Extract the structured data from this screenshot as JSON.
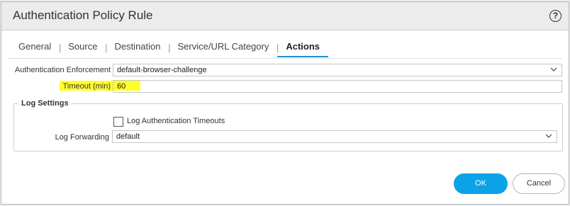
{
  "dialog": {
    "title": "Authentication Policy Rule",
    "help_symbol": "?"
  },
  "tabs": [
    {
      "label": "General"
    },
    {
      "label": "Source"
    },
    {
      "label": "Destination"
    },
    {
      "label": "Service/URL Category"
    },
    {
      "label": "Actions",
      "active": true
    }
  ],
  "tab_separator": "|",
  "form": {
    "auth_enforcement_label": "Authentication Enforcement",
    "auth_enforcement_value": "default-browser-challenge",
    "timeout_label": "Timeout (min)",
    "timeout_value": "60",
    "highlight_color": "#ffff2a"
  },
  "log_settings": {
    "legend": "Log Settings",
    "log_auth_timeouts_label": "Log Authentication Timeouts",
    "log_auth_timeouts_checked": false,
    "log_forwarding_label": "Log Forwarding",
    "log_forwarding_value": "default"
  },
  "buttons": {
    "ok": "OK",
    "cancel": "Cancel",
    "accent": "#0ba3e6"
  },
  "icons": {
    "help": "help-icon",
    "dropdown": "chevron-down-icon"
  }
}
